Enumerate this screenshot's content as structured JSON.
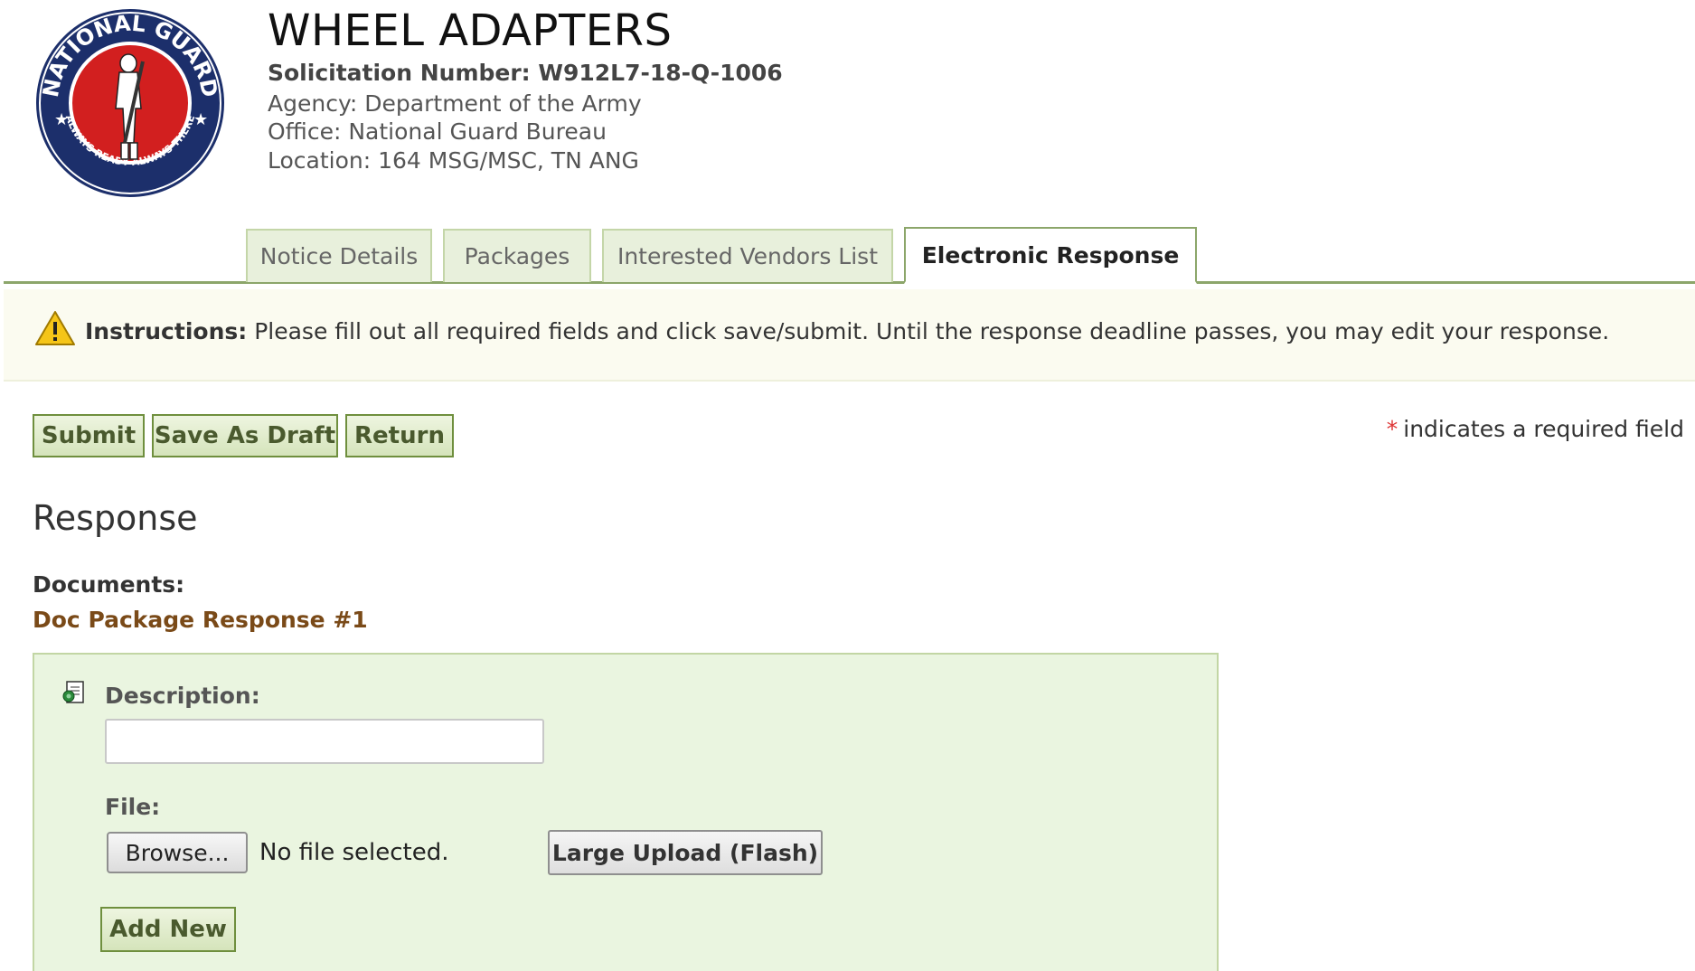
{
  "notice": {
    "title": "WHEEL ADAPTERS",
    "solicitation": "Solicitation Number: W912L7-18-Q-1006",
    "agency": "Agency: Department of the Army",
    "office": "Office: National Guard Bureau",
    "location": "Location: 164 MSG/MSC, TN ANG",
    "logo_text_top": "NATIONAL GUARD",
    "logo_text_bottom": "ALWAYS READY ALWAYS THERE"
  },
  "tabs": [
    {
      "label": "Notice Details",
      "active": false
    },
    {
      "label": "Packages",
      "active": false
    },
    {
      "label": "Interested Vendors List",
      "active": false
    },
    {
      "label": "Electronic Response",
      "active": true
    }
  ],
  "instructions": {
    "label": "Instructions:",
    "text": " Please fill out all required fields and click save/submit. Until the response deadline passes, you may edit your response."
  },
  "actions": {
    "submit": "Submit",
    "save_draft": "Save As Draft",
    "return": "Return"
  },
  "required_note": {
    "star": "*",
    "text": "indicates a required field"
  },
  "response": {
    "heading": "Response",
    "documents_label": "Documents:",
    "package_label": "Doc Package Response #1",
    "description_label": "Description:",
    "description_value": "",
    "file_label": "File:",
    "browse": "Browse...",
    "no_file": "No file selected.",
    "large_upload": "Large Upload (Flash)",
    "add_new": "Add New"
  },
  "colors": {
    "tab_border": "#8ca66a",
    "panel_bg": "#eaf5e0",
    "button_border": "#6f8f3e",
    "package_text": "#7a4a18"
  }
}
